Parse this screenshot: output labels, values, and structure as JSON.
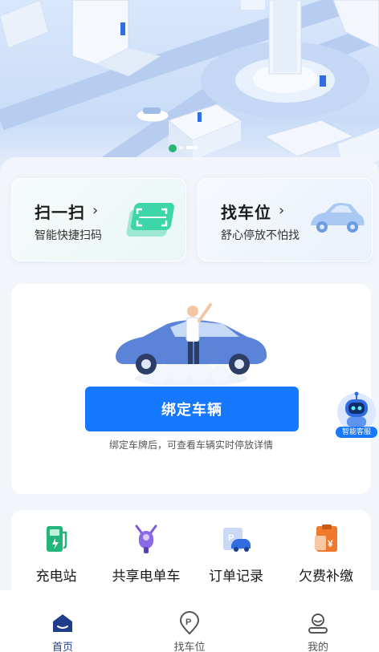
{
  "hero": {
    "slides": 2,
    "active_slide": 1
  },
  "quick_actions": {
    "scan": {
      "title": "扫一扫",
      "subtitle": "智能快捷扫码",
      "arrow": "›",
      "icon": "scan-card-icon"
    },
    "find_parking": {
      "title": "找车位",
      "subtitle": "舒心停放不怕找",
      "arrow": "›",
      "icon": "car-icon"
    }
  },
  "bind_vehicle": {
    "button_label": "绑定车辆",
    "note": "绑定车牌后，可查看车辆实时停放详情"
  },
  "services": [
    {
      "label": "充电站",
      "icon": "charging-station-icon"
    },
    {
      "label": "共享电单车",
      "icon": "e-bike-icon"
    },
    {
      "label": "订单记录",
      "icon": "order-record-icon"
    },
    {
      "label": "欠费补缴",
      "icon": "arrears-payment-icon"
    }
  ],
  "assistant": {
    "label": "智能客服"
  },
  "tabbar": {
    "active": "首页",
    "tabs": [
      {
        "label": "首页",
        "icon": "home-icon"
      },
      {
        "label": "找车位",
        "icon": "parking-icon"
      },
      {
        "label": "我的",
        "icon": "profile-icon"
      }
    ]
  },
  "colors": {
    "primary": "#1677ff",
    "tab_active": "#1f3d8a",
    "text": "#1a1a1a",
    "background": "#f2f5fa"
  }
}
